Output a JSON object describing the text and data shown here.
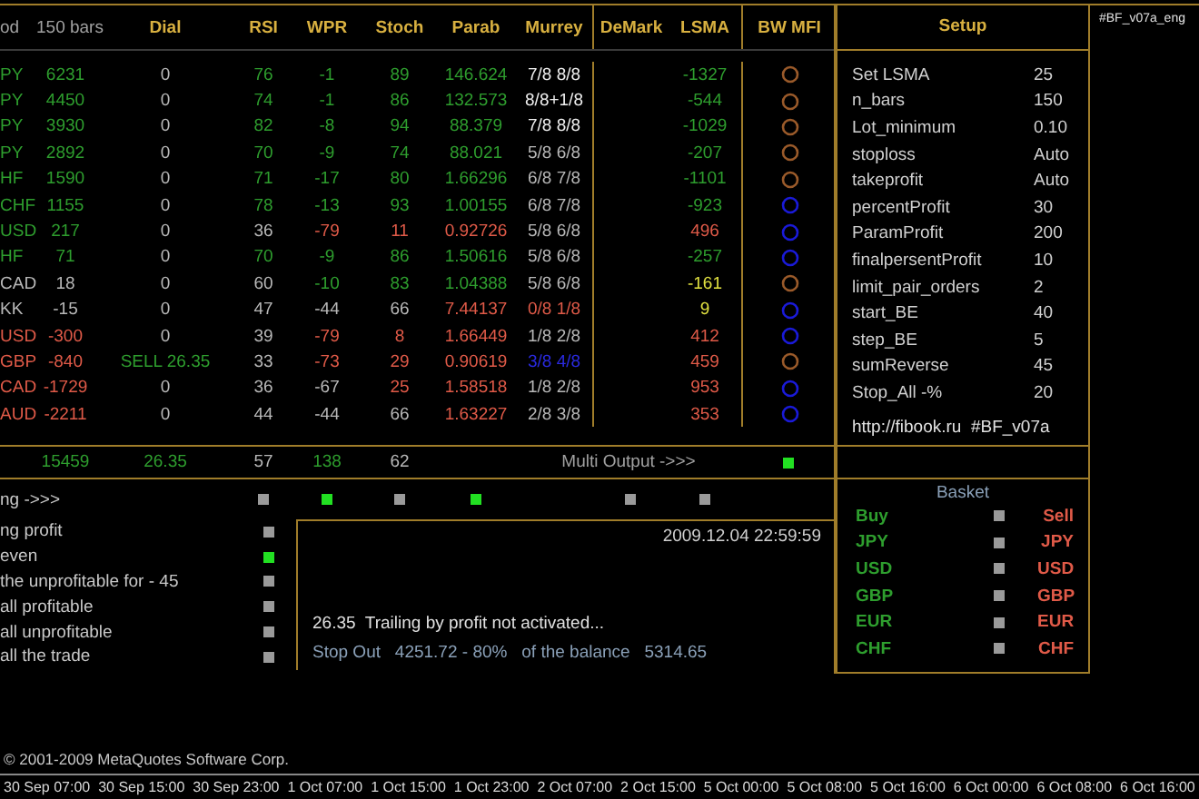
{
  "table": {
    "columns": [
      "od",
      "150 bars",
      "Dial",
      "RSI",
      "WPR",
      "Stoch",
      "Parab",
      "Murrey",
      "DeMark",
      "LSMA",
      "BW MFI"
    ],
    "rows": [
      {
        "cells": [
          {
            "text": "PY",
            "color": "#2e9e2e"
          },
          {
            "text": "6231",
            "color": "#2e9e2e"
          },
          {
            "text": "0",
            "color": "#b8b8b8"
          },
          {
            "text": "76",
            "color": "#2e9e2e"
          },
          {
            "text": "-1",
            "color": "#2e9e2e"
          },
          {
            "text": "89",
            "color": "#2e9e2e"
          },
          {
            "text": "146.624",
            "color": "#2e9e2e"
          },
          {
            "text": "7/8 8/8",
            "color": "#f0f0f0"
          },
          {
            "text": "-1327",
            "color": "#2e9e2e"
          }
        ],
        "mfi": {
          "color": "#9a5a2a"
        }
      },
      {
        "cells": [
          {
            "text": "PY",
            "color": "#2e9e2e"
          },
          {
            "text": "4450",
            "color": "#2e9e2e"
          },
          {
            "text": "0",
            "color": "#b8b8b8"
          },
          {
            "text": "74",
            "color": "#2e9e2e"
          },
          {
            "text": "-1",
            "color": "#2e9e2e"
          },
          {
            "text": "86",
            "color": "#2e9e2e"
          },
          {
            "text": "132.573",
            "color": "#2e9e2e"
          },
          {
            "text": "8/8+1/8",
            "color": "#f0f0f0"
          },
          {
            "text": "-544",
            "color": "#2e9e2e"
          }
        ],
        "mfi": {
          "color": "#9a5a2a"
        }
      },
      {
        "cells": [
          {
            "text": "PY",
            "color": "#2e9e2e"
          },
          {
            "text": "3930",
            "color": "#2e9e2e"
          },
          {
            "text": "0",
            "color": "#b8b8b8"
          },
          {
            "text": "82",
            "color": "#2e9e2e"
          },
          {
            "text": "-8",
            "color": "#2e9e2e"
          },
          {
            "text": "94",
            "color": "#2e9e2e"
          },
          {
            "text": "88.379",
            "color": "#2e9e2e"
          },
          {
            "text": "7/8 8/8",
            "color": "#f0f0f0"
          },
          {
            "text": "-1029",
            "color": "#2e9e2e"
          }
        ],
        "mfi": {
          "color": "#9a5a2a"
        }
      },
      {
        "cells": [
          {
            "text": "PY",
            "color": "#2e9e2e"
          },
          {
            "text": "2892",
            "color": "#2e9e2e"
          },
          {
            "text": "0",
            "color": "#b8b8b8"
          },
          {
            "text": "70",
            "color": "#2e9e2e"
          },
          {
            "text": "-9",
            "color": "#2e9e2e"
          },
          {
            "text": "74",
            "color": "#2e9e2e"
          },
          {
            "text": "88.021",
            "color": "#2e9e2e"
          },
          {
            "text": "5/8 6/8",
            "color": "#b8b8b8"
          },
          {
            "text": "-207",
            "color": "#2e9e2e"
          }
        ],
        "mfi": {
          "color": "#9a5a2a"
        }
      },
      {
        "cells": [
          {
            "text": "HF",
            "color": "#2e9e2e"
          },
          {
            "text": "1590",
            "color": "#2e9e2e"
          },
          {
            "text": "0",
            "color": "#b8b8b8"
          },
          {
            "text": "71",
            "color": "#2e9e2e"
          },
          {
            "text": "-17",
            "color": "#2e9e2e"
          },
          {
            "text": "80",
            "color": "#2e9e2e"
          },
          {
            "text": "1.66296",
            "color": "#2e9e2e"
          },
          {
            "text": "6/8 7/8",
            "color": "#b8b8b8"
          },
          {
            "text": "-1101",
            "color": "#2e9e2e"
          }
        ],
        "mfi": {
          "color": "#9a5a2a"
        }
      },
      {
        "cells": [
          {
            "text": "CHF",
            "color": "#2e9e2e"
          },
          {
            "text": "1155",
            "color": "#2e9e2e"
          },
          {
            "text": "0",
            "color": "#b8b8b8"
          },
          {
            "text": "78",
            "color": "#2e9e2e"
          },
          {
            "text": "-13",
            "color": "#2e9e2e"
          },
          {
            "text": "93",
            "color": "#2e9e2e"
          },
          {
            "text": "1.00155",
            "color": "#2e9e2e"
          },
          {
            "text": "6/8 7/8",
            "color": "#b8b8b8"
          },
          {
            "text": "-923",
            "color": "#2e9e2e"
          }
        ],
        "mfi": {
          "color": "#1a1ad8"
        }
      },
      {
        "cells": [
          {
            "text": "USD",
            "color": "#2e9e2e"
          },
          {
            "text": "217",
            "color": "#2e9e2e"
          },
          {
            "text": "0",
            "color": "#b8b8b8"
          },
          {
            "text": "36",
            "color": "#b8b8b8"
          },
          {
            "text": "-79",
            "color": "#e05a48"
          },
          {
            "text": "11",
            "color": "#e05a48"
          },
          {
            "text": "0.92726",
            "color": "#e05a48"
          },
          {
            "text": "5/8 6/8",
            "color": "#b8b8b8"
          },
          {
            "text": "496",
            "color": "#e05a48"
          }
        ],
        "mfi": {
          "color": "#1a1ad8"
        }
      },
      {
        "cells": [
          {
            "text": "HF",
            "color": "#2e9e2e"
          },
          {
            "text": "71",
            "color": "#2e9e2e"
          },
          {
            "text": "0",
            "color": "#b8b8b8"
          },
          {
            "text": "70",
            "color": "#2e9e2e"
          },
          {
            "text": "-9",
            "color": "#2e9e2e"
          },
          {
            "text": "86",
            "color": "#2e9e2e"
          },
          {
            "text": "1.50616",
            "color": "#2e9e2e"
          },
          {
            "text": "5/8 6/8",
            "color": "#b8b8b8"
          },
          {
            "text": "-257",
            "color": "#2e9e2e"
          }
        ],
        "mfi": {
          "color": "#1a1ad8"
        }
      },
      {
        "cells": [
          {
            "text": "CAD",
            "color": "#b8b8b8"
          },
          {
            "text": "18",
            "color": "#b8b8b8"
          },
          {
            "text": "0",
            "color": "#b8b8b8"
          },
          {
            "text": "60",
            "color": "#b8b8b8"
          },
          {
            "text": "-10",
            "color": "#2e9e2e"
          },
          {
            "text": "83",
            "color": "#2e9e2e"
          },
          {
            "text": "1.04388",
            "color": "#2e9e2e"
          },
          {
            "text": "5/8 6/8",
            "color": "#b8b8b8"
          },
          {
            "text": "-161",
            "color": "#e0e040"
          }
        ],
        "mfi": {
          "color": "#9a5a2a"
        }
      },
      {
        "cells": [
          {
            "text": "KK",
            "color": "#b8b8b8"
          },
          {
            "text": "-15",
            "color": "#b8b8b8"
          },
          {
            "text": "0",
            "color": "#b8b8b8"
          },
          {
            "text": "47",
            "color": "#b8b8b8"
          },
          {
            "text": "-44",
            "color": "#b8b8b8"
          },
          {
            "text": "66",
            "color": "#b8b8b8"
          },
          {
            "text": "7.44137",
            "color": "#e05a48"
          },
          {
            "text": "0/8 1/8",
            "color": "#e05a48"
          },
          {
            "text": "9",
            "color": "#e0e040"
          }
        ],
        "mfi": {
          "color": "#1a1ad8"
        }
      },
      {
        "cells": [
          {
            "text": "USD",
            "color": "#e05a48"
          },
          {
            "text": "-300",
            "color": "#e05a48"
          },
          {
            "text": "0",
            "color": "#b8b8b8"
          },
          {
            "text": "39",
            "color": "#b8b8b8"
          },
          {
            "text": "-79",
            "color": "#e05a48"
          },
          {
            "text": "8",
            "color": "#e05a48"
          },
          {
            "text": "1.66449",
            "color": "#e05a48"
          },
          {
            "text": "1/8 2/8",
            "color": "#b8b8b8"
          },
          {
            "text": "412",
            "color": "#e05a48"
          }
        ],
        "mfi": {
          "color": "#1a1ad8"
        }
      },
      {
        "cells": [
          {
            "text": "GBP",
            "color": "#e05a48"
          },
          {
            "text": "-840",
            "color": "#e05a48"
          },
          {
            "text": "SELL 26.35",
            "color": "#2e9e2e"
          },
          {
            "text": "33",
            "color": "#b8b8b8"
          },
          {
            "text": "-73",
            "color": "#e05a48"
          },
          {
            "text": "29",
            "color": "#e05a48"
          },
          {
            "text": "0.90619",
            "color": "#e05a48"
          },
          {
            "text": "3/8 4/8",
            "color": "#2a2ae0"
          },
          {
            "text": "459",
            "color": "#e05a48"
          }
        ],
        "mfi": {
          "color": "#9a5a2a"
        }
      },
      {
        "cells": [
          {
            "text": "CAD",
            "color": "#e05a48"
          },
          {
            "text": "-1729",
            "color": "#e05a48"
          },
          {
            "text": "0",
            "color": "#b8b8b8"
          },
          {
            "text": "36",
            "color": "#b8b8b8"
          },
          {
            "text": "-67",
            "color": "#b8b8b8"
          },
          {
            "text": "25",
            "color": "#e05a48"
          },
          {
            "text": "1.58518",
            "color": "#e05a48"
          },
          {
            "text": "1/8 2/8",
            "color": "#b8b8b8"
          },
          {
            "text": "953",
            "color": "#e05a48"
          }
        ],
        "mfi": {
          "color": "#1a1ad8"
        }
      },
      {
        "cells": [
          {
            "text": "AUD",
            "color": "#e05a48"
          },
          {
            "text": "-2211",
            "color": "#e05a48"
          },
          {
            "text": "0",
            "color": "#b8b8b8"
          },
          {
            "text": "44",
            "color": "#b8b8b8"
          },
          {
            "text": "-44",
            "color": "#b8b8b8"
          },
          {
            "text": "66",
            "color": "#b8b8b8"
          },
          {
            "text": "1.63227",
            "color": "#e05a48"
          },
          {
            "text": "2/8 3/8",
            "color": "#b8b8b8"
          },
          {
            "text": "353",
            "color": "#e05a48"
          }
        ],
        "mfi": {
          "color": "#1a1ad8"
        }
      }
    ],
    "totals": [
      {
        "text": "15459",
        "color": "#2e9e2e"
      },
      {
        "text": "26.35",
        "color": "#2e9e2e"
      },
      {
        "text": "57",
        "color": "#b8b8b8"
      },
      {
        "text": "138",
        "color": "#2e9e2e"
      },
      {
        "text": "62",
        "color": "#b8b8b8"
      }
    ],
    "multi_output": {
      "label": "Multi Output ->>>",
      "on": true
    }
  },
  "setup": {
    "title": "Setup",
    "params": [
      {
        "name": "Set LSMA",
        "value": "25"
      },
      {
        "name": "n_bars",
        "value": "150"
      },
      {
        "name": "Lot_minimum",
        "value": "0.10"
      },
      {
        "name": "stoploss",
        "value": "Auto"
      },
      {
        "name": "takeprofit",
        "value": "Auto"
      },
      {
        "name": "percentProfit",
        "value": "30"
      },
      {
        "name": "ParamProfit",
        "value": "200"
      },
      {
        "name": "finalpersentProfit",
        "value": "10"
      },
      {
        "name": "limit_pair_orders",
        "value": "2"
      },
      {
        "name": "start_BE",
        "value": "40"
      },
      {
        "name": "step_BE",
        "value": "5"
      },
      {
        "name": "sumReverse",
        "value": "45"
      },
      {
        "name": "Stop_All -%",
        "value": "20"
      }
    ],
    "footer": "http://fibook.ru  #BF_v07a"
  },
  "tag": "#BF_v07a_eng",
  "signals": {
    "label": "ng ->>>",
    "indicators": [
      {
        "on": false
      },
      {
        "on": true
      },
      {
        "on": false
      },
      {
        "on": true
      },
      {
        "on": false
      },
      {
        "on": false
      }
    ]
  },
  "options": [
    {
      "label": "ng profit",
      "on": false
    },
    {
      "label": "even",
      "on": true
    },
    {
      "label": "the unprofitable for - 45",
      "on": false
    },
    {
      "label": "all profitable",
      "on": false
    },
    {
      "label": "all unprofitable",
      "on": false
    },
    {
      "label": "all the trade",
      "on": false
    }
  ],
  "info": {
    "datetime": "2009.12.04 22:59:59",
    "message": "26.35  Trailing by profit not activated...",
    "stop_out": "Stop Out   4251.72 - 80%   of the balance   5314.65"
  },
  "basket": {
    "title": "Basket",
    "rows": [
      {
        "buy": "Buy",
        "on": false,
        "sell": "Sell"
      },
      {
        "buy": "JPY",
        "on": false,
        "sell": "JPY"
      },
      {
        "buy": "USD",
        "on": false,
        "sell": "USD"
      },
      {
        "buy": "GBP",
        "on": false,
        "sell": "GBP"
      },
      {
        "buy": "EUR",
        "on": false,
        "sell": "EUR"
      },
      {
        "buy": "CHF",
        "on": false,
        "sell": "CHF"
      }
    ]
  },
  "copyright": "© 2001-2009 MetaQuotes Software Corp.",
  "timeline": [
    "30 Sep 07:00",
    "30 Sep 15:00",
    "30 Sep 23:00",
    "1 Oct 07:00",
    "1 Oct 15:00",
    "1 Oct 23:00",
    "2 Oct 07:00",
    "2 Oct 15:00",
    "5 Oct 00:00",
    "5 Oct 08:00",
    "5 Oct 16:00",
    "6 Oct 00:00",
    "6 Oct 08:00",
    "6 Oct 16:00"
  ]
}
